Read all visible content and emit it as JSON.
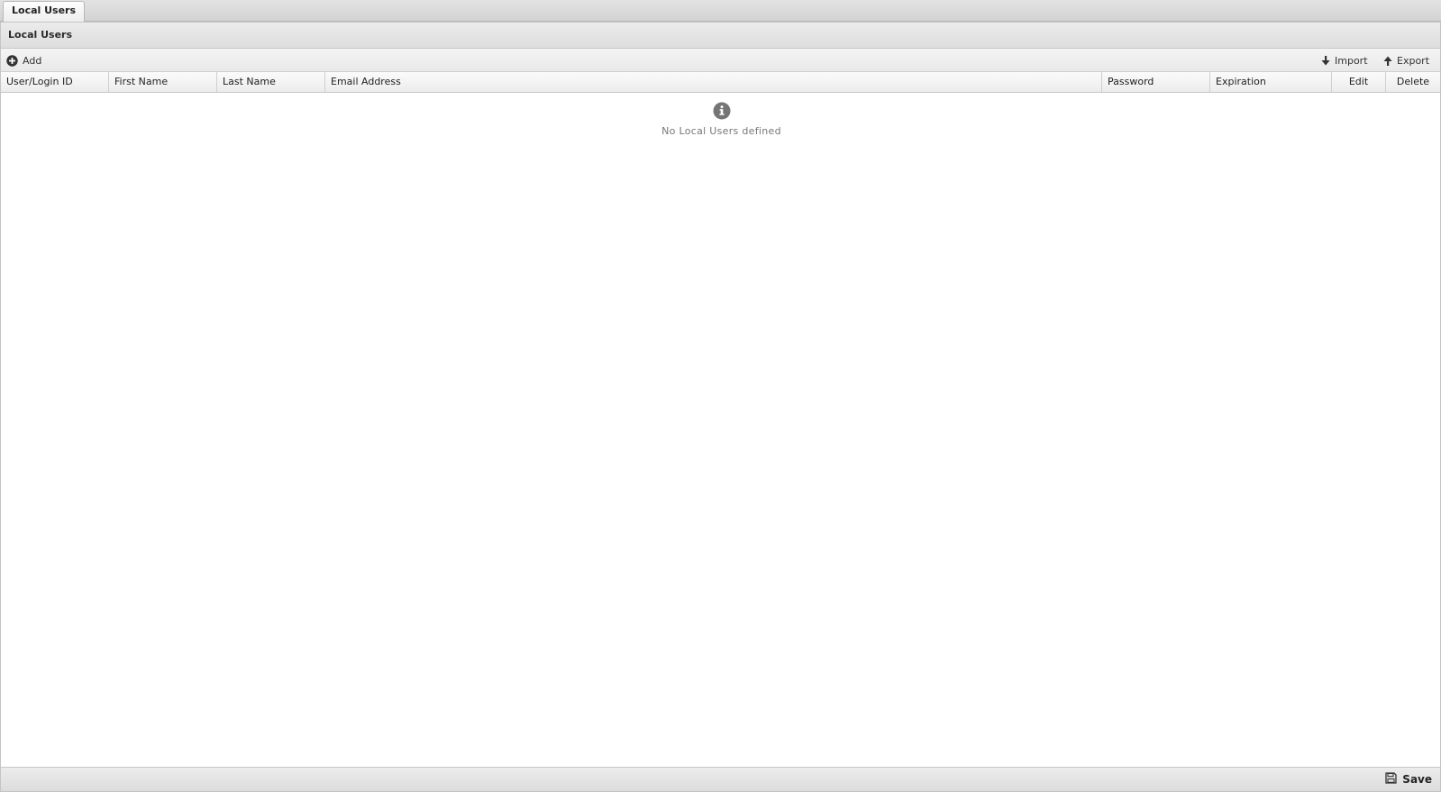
{
  "tabs": [
    {
      "label": "Local Users",
      "active": true
    }
  ],
  "panel": {
    "title": "Local Users"
  },
  "toolbar": {
    "add_label": "Add",
    "import_label": "Import",
    "export_label": "Export",
    "icons": {
      "add": "plus-circle-icon",
      "import": "arrow-down-icon",
      "export": "arrow-up-icon"
    }
  },
  "grid": {
    "columns": [
      {
        "label": "User/Login ID"
      },
      {
        "label": "First Name"
      },
      {
        "label": "Last Name"
      },
      {
        "label": "Email Address"
      },
      {
        "label": "Password"
      },
      {
        "label": "Expiration"
      },
      {
        "label": "Edit"
      },
      {
        "label": "Delete"
      }
    ],
    "empty_message": "No Local Users defined",
    "empty_icon": "info-icon"
  },
  "footer": {
    "save_label": "Save",
    "save_icon": "floppy-disk-icon"
  },
  "colors": {
    "icon": "#333333",
    "info_icon": "#757575",
    "empty_text": "#777777"
  }
}
